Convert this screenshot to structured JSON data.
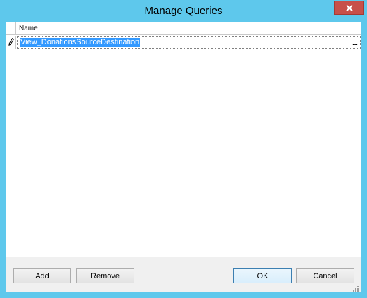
{
  "window": {
    "title": "Manage Queries"
  },
  "grid": {
    "columns": [
      "Name"
    ],
    "rows": [
      {
        "name": "View_DonationsSourceDestination",
        "editing": true,
        "ellipsis": "..."
      }
    ]
  },
  "buttons": {
    "add": "Add",
    "remove": "Remove",
    "ok": "OK",
    "cancel": "Cancel"
  },
  "colors": {
    "frame": "#5ec8ec",
    "close": "#c7504a",
    "selection": "#3399ff"
  },
  "icons": {
    "close": "close-icon",
    "row_edit": "pencil-icon",
    "resize": "resize-grip-icon"
  }
}
